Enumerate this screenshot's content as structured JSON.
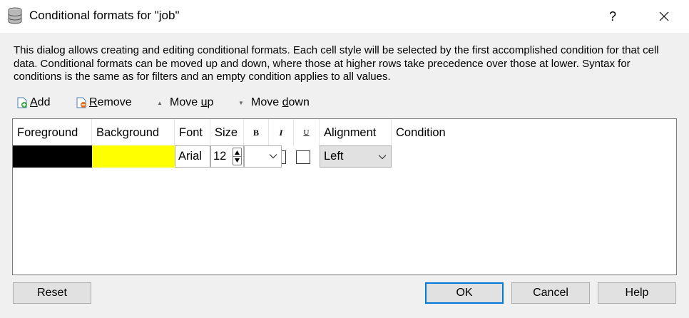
{
  "window": {
    "title": "Conditional formats for \"job\"",
    "help": "?",
    "icon": "database-icon"
  },
  "description": "This dialog allows creating and editing conditional formats. Each cell style will be selected by the first accomplished condition for that cell data. Conditional formats can be moved up and down, where those at higher rows take precedence over those at lower. Syntax for conditions is the same as for filters and an empty condition applies to all values.",
  "toolbar": {
    "add_mnemonic": "A",
    "add_rest": "dd",
    "remove_mnemonic": "R",
    "remove_rest": "emove",
    "moveup_prefix": "Move ",
    "moveup_mnemonic": "u",
    "moveup_rest": "p",
    "movedown_prefix": "Move ",
    "movedown_mnemonic": "d",
    "movedown_rest": "own"
  },
  "table": {
    "headers": {
      "foreground": "Foreground",
      "background": "Background",
      "font": "Font",
      "size": "Size",
      "bold": "B",
      "italic": "I",
      "underline": "U",
      "alignment": "Alignment",
      "condition": "Condition"
    },
    "row": {
      "foreground_color": "#000000",
      "background_color": "#ffff00",
      "font": "Arial",
      "size": "12",
      "alignment": "Left",
      "condition": ""
    }
  },
  "buttons": {
    "reset": "Reset",
    "ok": "OK",
    "cancel": "Cancel",
    "help": "Help"
  },
  "colors": {
    "accent": "#0078d7"
  }
}
